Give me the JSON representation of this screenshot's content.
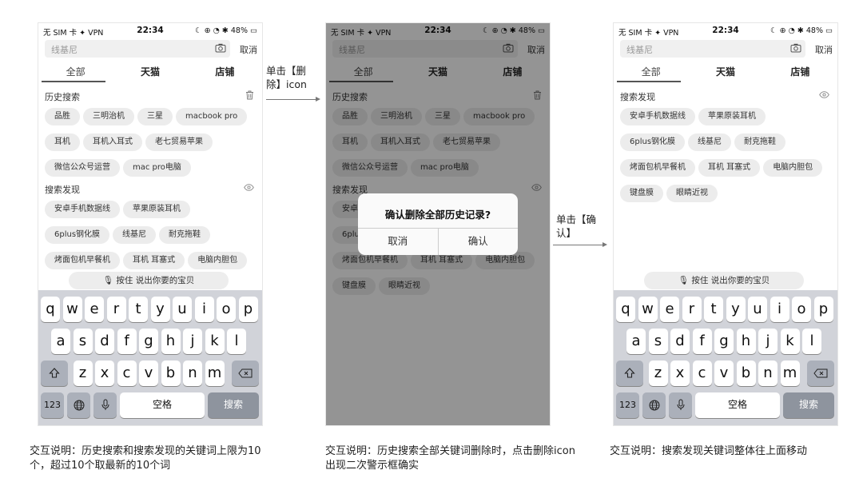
{
  "status": {
    "left": "无 SIM 卡 ✦ VPN",
    "time": "22:34",
    "right": "☾ ⊕ ◔ ✱ 48% ▭"
  },
  "search": {
    "placeholder": "线基尼",
    "cancel": "取消"
  },
  "tabs": [
    "全部",
    "天猫",
    "店铺"
  ],
  "history": {
    "title": "历史搜索",
    "items": [
      "品胜",
      "三明治机",
      "三星",
      "macbook pro",
      "耳机",
      "耳机入耳式",
      "老七贸易苹果",
      "微信公众号运营",
      "mac pro电脑"
    ]
  },
  "discover": {
    "title": "搜索发现",
    "items": [
      "安卓手机数据线",
      "苹果原装耳机",
      "6plus钢化膜",
      "线基尼",
      "耐克拖鞋",
      "烤面包机早餐机",
      "耳机 耳塞式",
      "电脑内胆包",
      "键盘膜",
      "眼睛近视"
    ]
  },
  "voice": {
    "label": "按住 说出你要的宝贝"
  },
  "keyboard": {
    "row1": [
      "q",
      "w",
      "e",
      "r",
      "t",
      "y",
      "u",
      "i",
      "o",
      "p"
    ],
    "row2": [
      "a",
      "s",
      "d",
      "f",
      "g",
      "h",
      "j",
      "k",
      "l"
    ],
    "row3": [
      "z",
      "x",
      "c",
      "v",
      "b",
      "n",
      "m"
    ],
    "num": "123",
    "space": "空格",
    "search": "搜索"
  },
  "dialog": {
    "message": "确认删除全部历史记录?",
    "cancel": "取消",
    "confirm": "确认"
  },
  "arrows": {
    "a1": "单击【删除】icon",
    "a2": "单击【确认】"
  },
  "notes": {
    "n1": "交互说明：历史搜索和搜索发现的关键词上限为10个，超过10个取最新的10个词",
    "n2": "交互说明：历史搜索全部关键词删除时，点击删除icon出现二次警示框确实",
    "n3": "交互说明：搜索发现关键词整体往上面移动"
  }
}
